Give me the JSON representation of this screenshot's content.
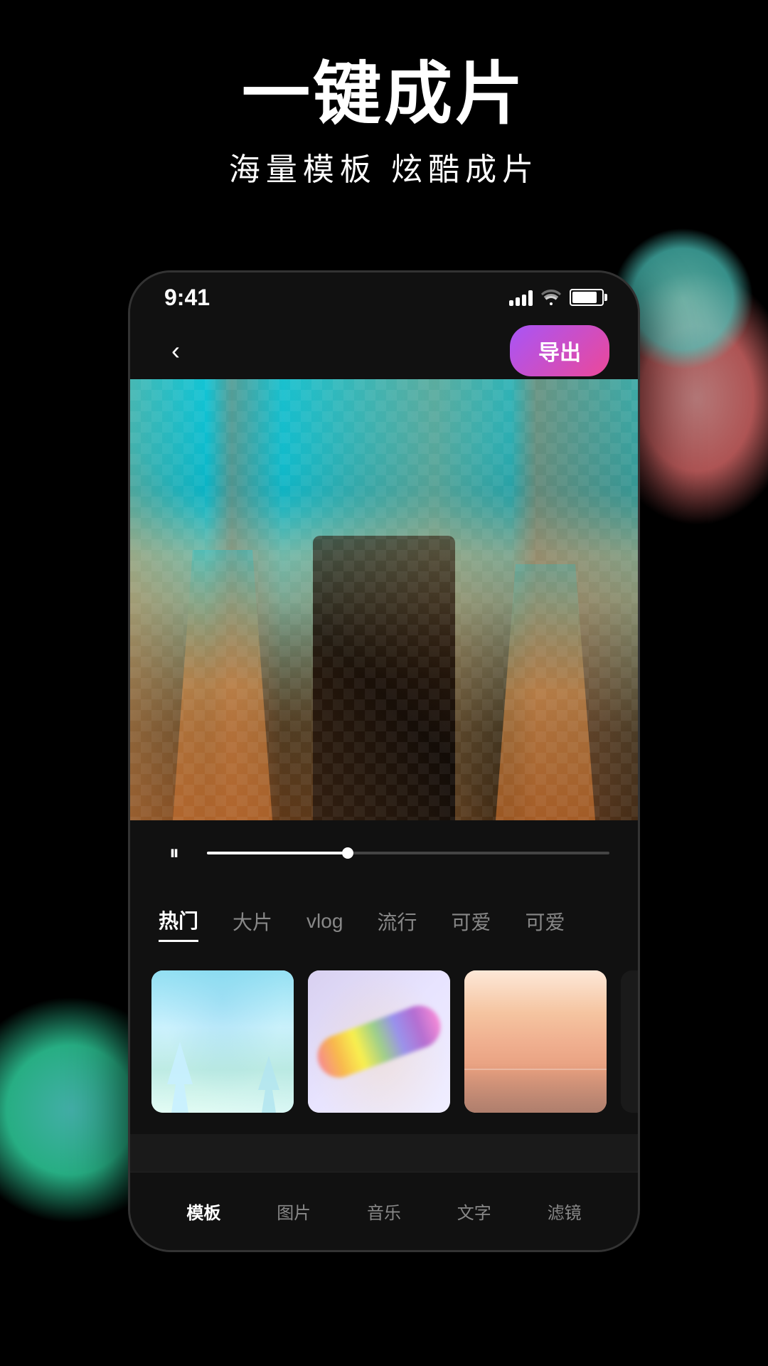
{
  "page": {
    "background_color": "#000000"
  },
  "header": {
    "main_title": "一键成片",
    "sub_title": "海量模板  炫酷成片"
  },
  "status_bar": {
    "time": "9:41",
    "signal": "●●●●",
    "wifi": "wifi",
    "battery": "battery"
  },
  "nav": {
    "back_label": "‹",
    "export_label": "导出"
  },
  "playback": {
    "icon": "⏸"
  },
  "categories": [
    {
      "id": "hot",
      "label": "热门",
      "active": true
    },
    {
      "id": "film",
      "label": "大片",
      "active": false
    },
    {
      "id": "vlog",
      "label": "vlog",
      "active": false
    },
    {
      "id": "trend",
      "label": "流行",
      "active": false
    },
    {
      "id": "cute1",
      "label": "可爱",
      "active": false
    },
    {
      "id": "cute2",
      "label": "可爱",
      "active": false
    }
  ],
  "templates": [
    {
      "id": 1,
      "type": "sky"
    },
    {
      "id": 2,
      "type": "rainbow"
    },
    {
      "id": 3,
      "type": "sunset"
    },
    {
      "id": 4,
      "type": "dark"
    }
  ],
  "bottom_nav": [
    {
      "id": "template",
      "label": "模板",
      "active": true
    },
    {
      "id": "image",
      "label": "图片",
      "active": false
    },
    {
      "id": "music",
      "label": "音乐",
      "active": false
    },
    {
      "id": "text",
      "label": "文字",
      "active": false
    },
    {
      "id": "filter",
      "label": "滤镜",
      "active": false
    }
  ]
}
